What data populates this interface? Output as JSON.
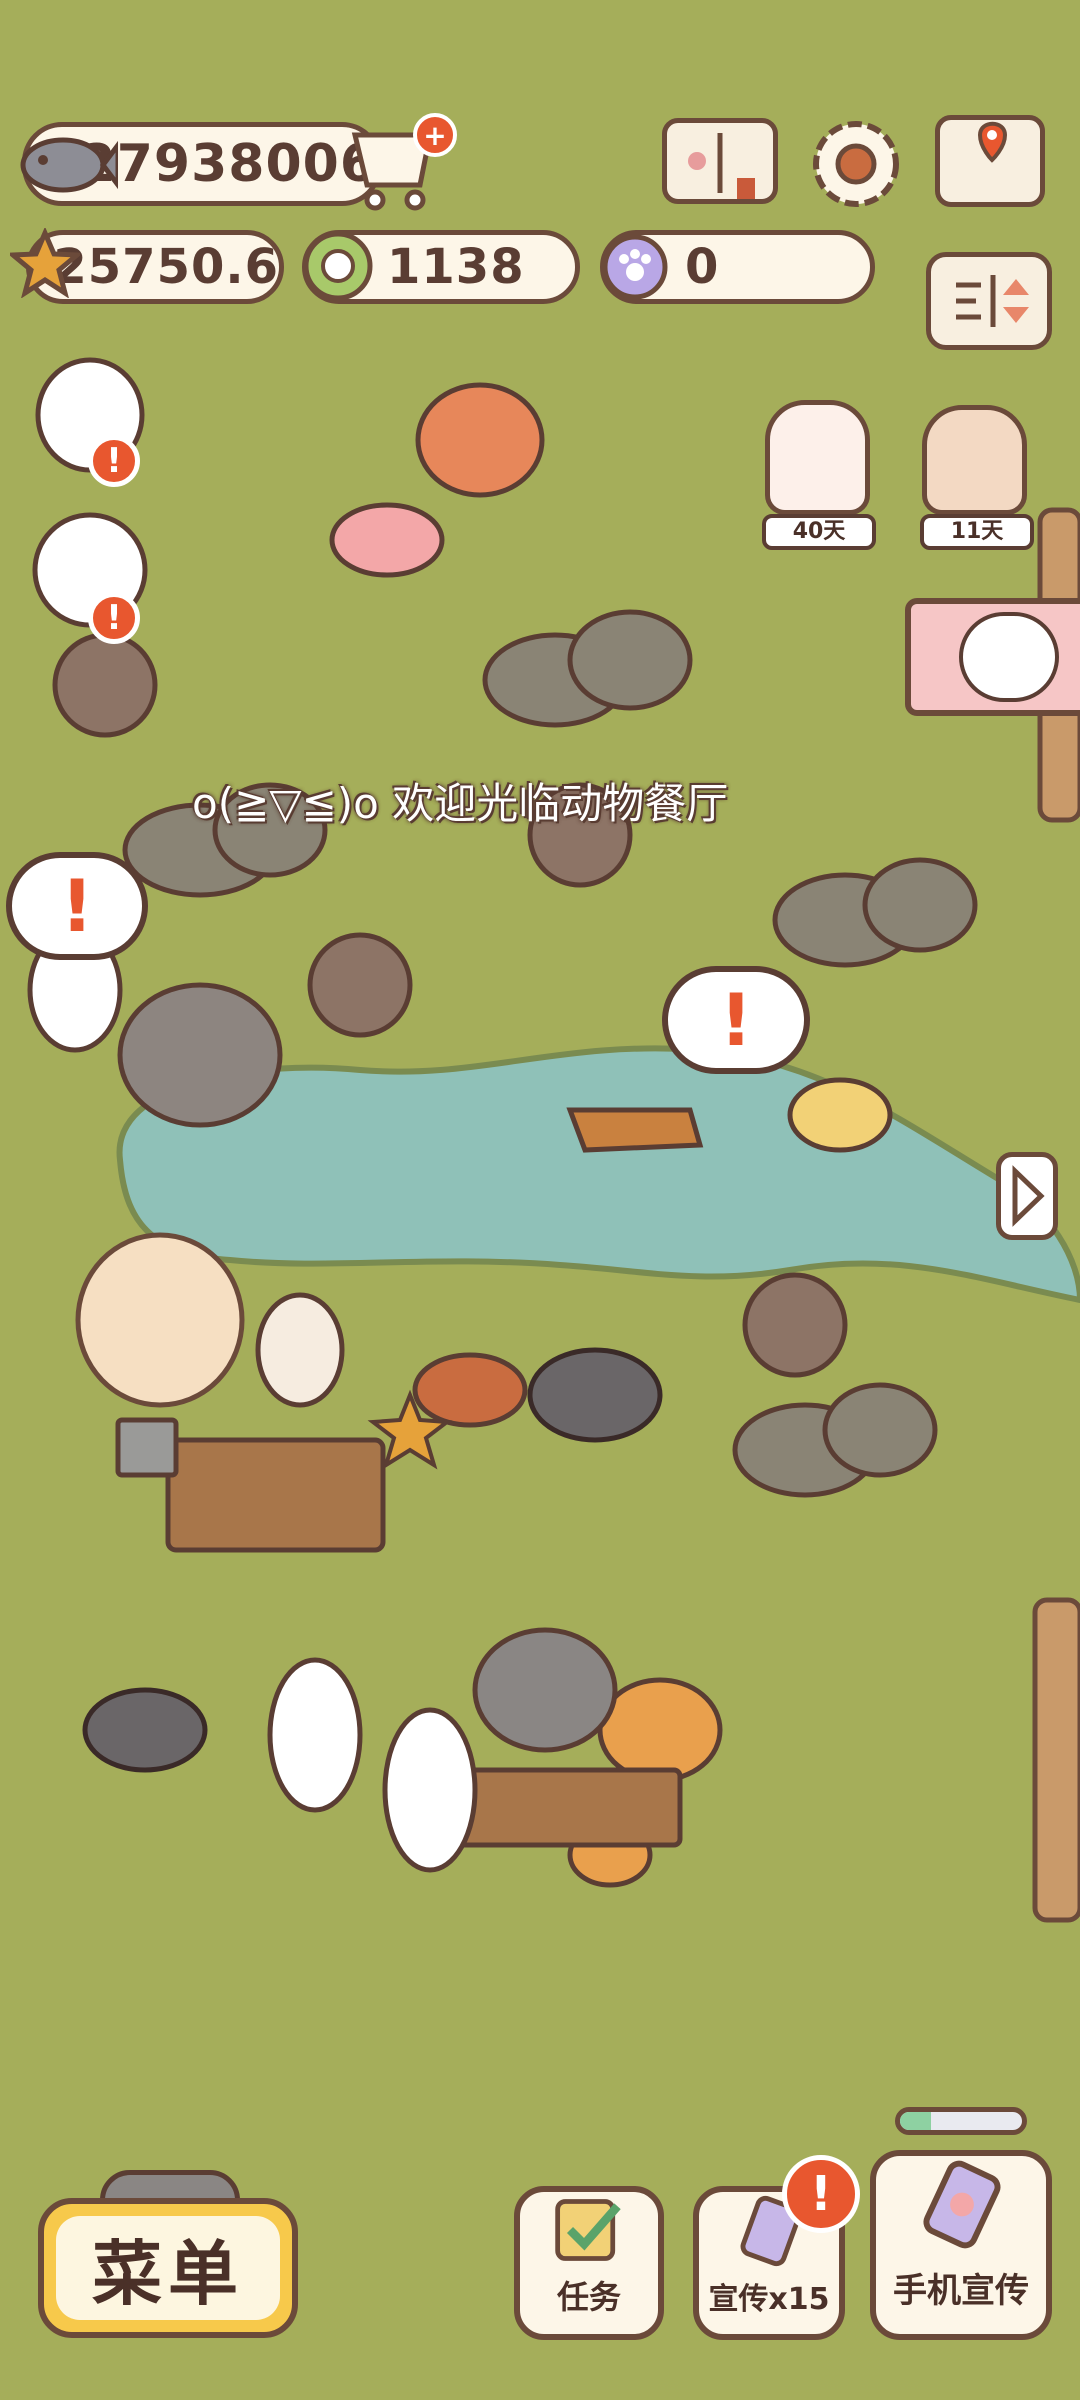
{
  "currency": {
    "fish": "27938006",
    "stars": "25750.6",
    "tokens": "1138",
    "paws": "0"
  },
  "banner": "o(≧▽≦)o 欢迎光临动物餐厅",
  "events": [
    {
      "days": "40天"
    },
    {
      "days": "11天"
    }
  ],
  "bottom": {
    "menu": "菜单",
    "tasks": "任务",
    "promo_x15": "宣传x15",
    "phone_promo": "手机宣传",
    "promo_progress": 0.25
  },
  "icons": {
    "fish": "fish-icon",
    "shop": "shop-cart-icon",
    "book": "recipe-book-icon",
    "settings": "gear-icon",
    "map": "map-icon",
    "star": "star-icon",
    "token": "green-token-icon",
    "paw": "paw-coin-icon",
    "sort": "sort-toggle-icon",
    "next": "next-arrow-icon"
  },
  "colors": {
    "grass": "#a5ae5a",
    "water": "#8fc1b8",
    "ink": "#5a3d33",
    "alert": "#e8572f",
    "menu_yellow": "#f7c94b"
  }
}
